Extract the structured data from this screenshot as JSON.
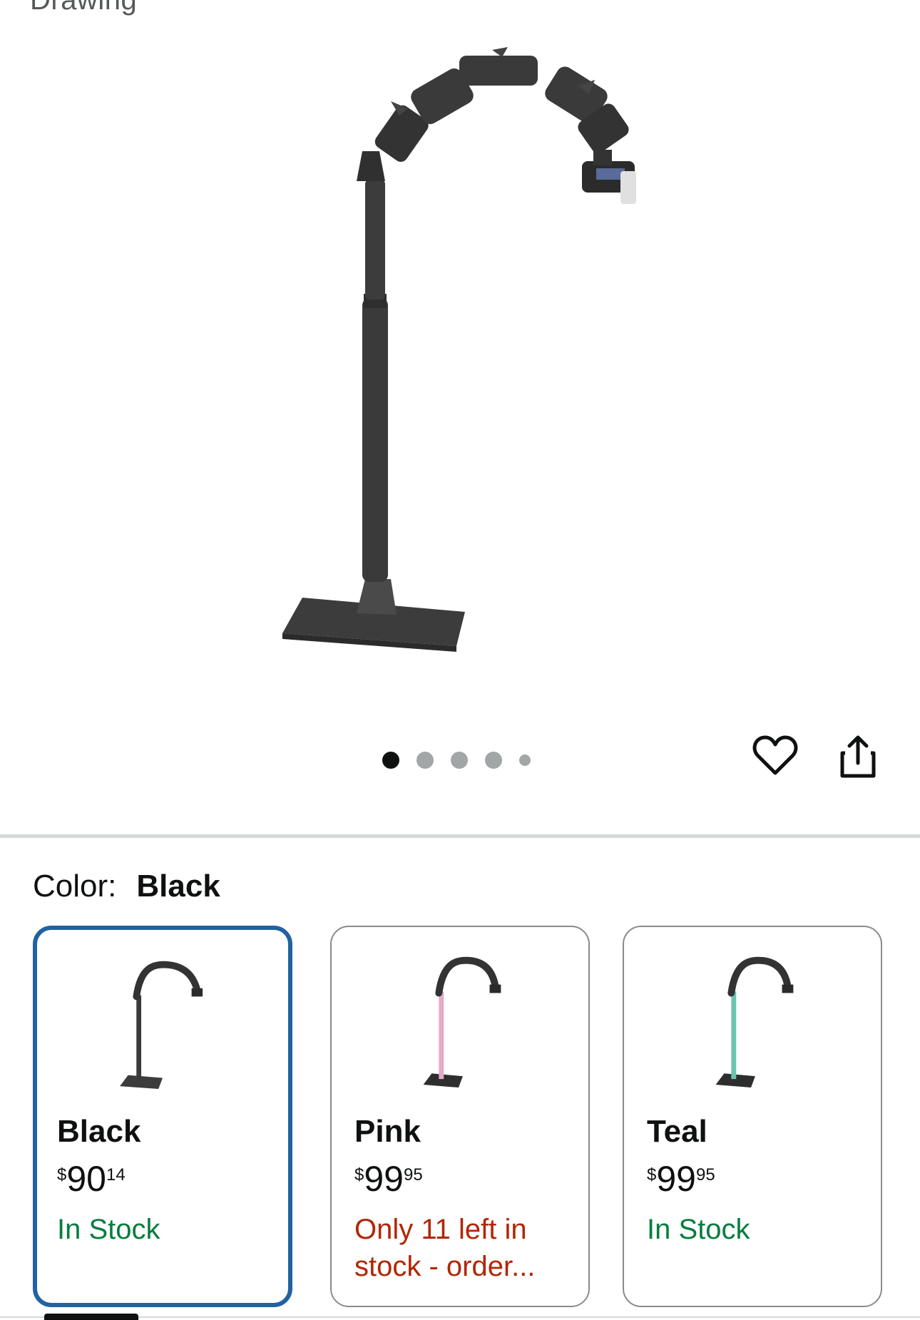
{
  "header": {
    "title": "Drawing"
  },
  "gallery": {
    "image_alt": "Black overhead phone stand with articulating arm",
    "dot_count": 5,
    "active_index": 0,
    "wishlist_icon": "heart-icon",
    "share_icon": "share-icon"
  },
  "variation": {
    "label": "Color:",
    "selected": "Black",
    "options": [
      {
        "name": "Black",
        "price": {
          "currency": "$",
          "whole": "90",
          "fraction": "14"
        },
        "availability": "In Stock",
        "status_color": "#067d3e",
        "pole_color": "#3a3a3a",
        "selected": true
      },
      {
        "name": "Pink",
        "price": {
          "currency": "$",
          "whole": "99",
          "fraction": "95"
        },
        "availability": "Only 11 left in stock - order...",
        "status_color": "#b12704",
        "pole_color": "#e8a8c8",
        "selected": false
      },
      {
        "name": "Teal",
        "price": {
          "currency": "$",
          "whole": "99",
          "fraction": "95"
        },
        "availability": "In Stock",
        "status_color": "#067d3e",
        "pole_color": "#6cc4ae",
        "selected": false
      }
    ]
  },
  "colors": {
    "selected_border": "#2162a1",
    "in_stock": "#067d3e",
    "low_stock": "#b12704"
  }
}
